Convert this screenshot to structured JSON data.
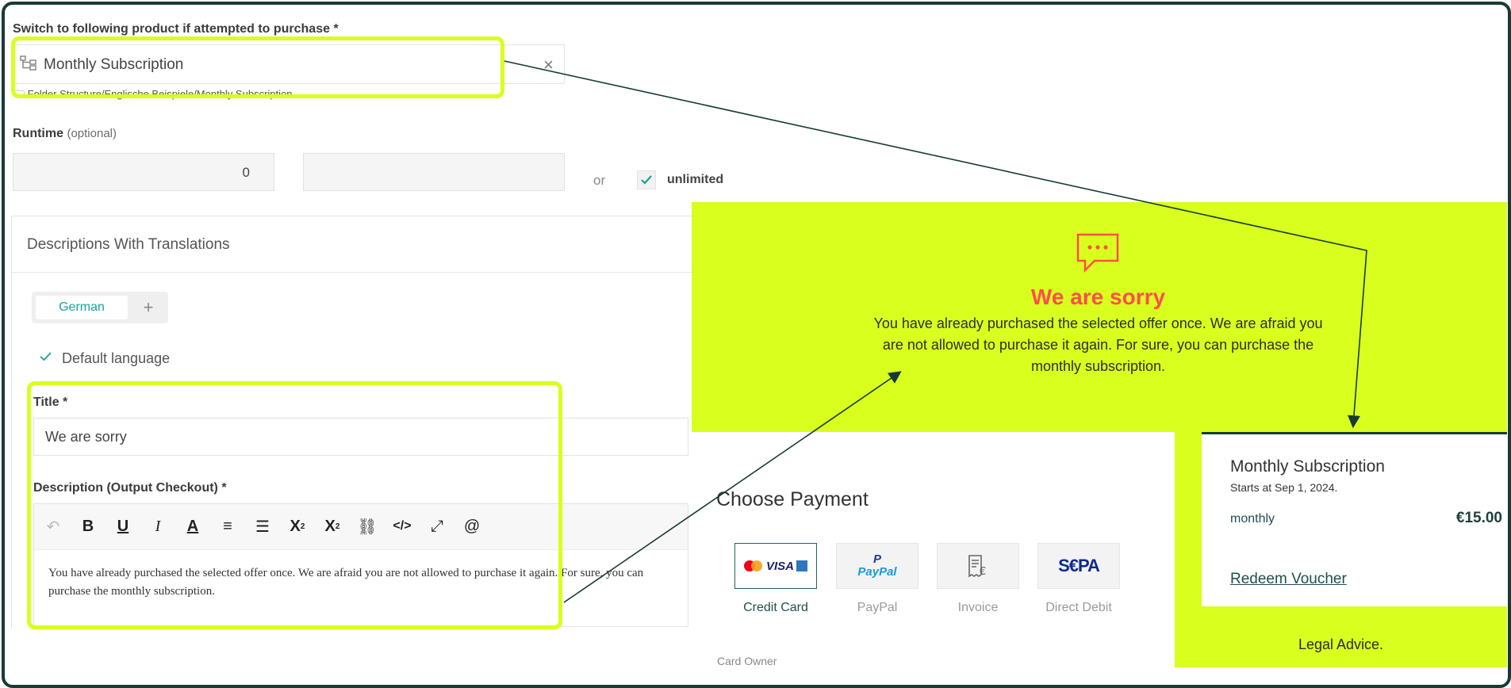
{
  "switch_section": {
    "label": "Switch to following product if attempted to purchase *",
    "selected_product": "Monthly Subscription",
    "product_path": "Folder Structure/Englische Beispiele/Monthly Subscription",
    "clear_icon": "×"
  },
  "runtime": {
    "label": "Runtime",
    "optional": "(optional)",
    "value": "0",
    "unit_value": "",
    "or_text": "or",
    "unlimited_label": "unlimited",
    "unlimited_checked": true
  },
  "descriptions": {
    "header": "Descriptions With Translations",
    "tab_german": "German",
    "add_tab": "+",
    "default_language": "Default language",
    "title_label": "Title *",
    "title_value": "We are sorry",
    "description_label": "Description (Output Checkout) *",
    "description_text": "You have already purchased the selected offer once. We are afraid you are not allowed to purchase it again. For sure, you can purchase the monthly subscription."
  },
  "toolbar_icons": [
    "undo-icon",
    "bold-icon",
    "underline-icon",
    "italic-icon",
    "font-color-icon",
    "align-icon",
    "ordered-list-icon",
    "subscript-icon",
    "superscript-icon",
    "unlink-icon",
    "code-icon",
    "fullscreen-icon",
    "mention-icon"
  ],
  "sorry_panel": {
    "title": "We are sorry",
    "line1": "You have already purchased the selected offer once. We are afraid you",
    "line2": "are not allowed to purchase it again. For sure, you can purchase the",
    "line3": "monthly subscription."
  },
  "payment": {
    "header": "Choose Payment",
    "methods": [
      "Credit Card",
      "PayPal",
      "Invoice",
      "Direct Debit"
    ],
    "paypal_logo": "PayPal",
    "sepa_logo": "S€PA",
    "card_owner_label": "Card Owner"
  },
  "summary": {
    "product": "Monthly Subscription",
    "starts": "Starts at Sep 1, 2024.",
    "interval": "monthly",
    "price": "€15.00",
    "redeem": "Redeem Voucher",
    "legal": "Legal Advice."
  },
  "colors": {
    "highlight": "#d9ff1e",
    "accent_red": "#ff4d4d",
    "accent_teal": "#1aa39a",
    "frame": "#173a35"
  }
}
